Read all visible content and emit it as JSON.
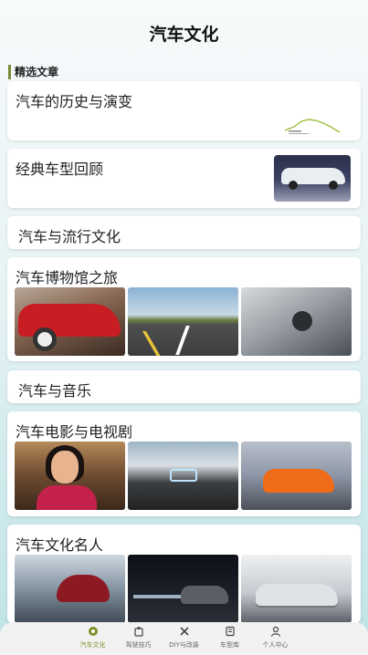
{
  "header": {
    "title": "汽车文化"
  },
  "section": {
    "label": "精选文章"
  },
  "articles": [
    {
      "title": "汽车的历史与演变"
    },
    {
      "title": "经典车型回顾"
    },
    {
      "title": "汽车与流行文化"
    },
    {
      "title": "汽车博物馆之旅"
    },
    {
      "title": "汽车与音乐"
    },
    {
      "title": "汽车电影与电视剧"
    },
    {
      "title": "汽车文化名人"
    }
  ],
  "tabbar": {
    "items": [
      {
        "label": "汽车文化",
        "icon": "steering-wheel-icon",
        "active": true
      },
      {
        "label": "驾驶技巧",
        "icon": "driver-icon",
        "active": false
      },
      {
        "label": "DIY与改装",
        "icon": "tools-icon",
        "active": false
      },
      {
        "label": "车型库",
        "icon": "book-icon",
        "active": false
      },
      {
        "label": "个人中心",
        "icon": "user-icon",
        "active": false
      }
    ]
  },
  "colors": {
    "accent": "#7f8f2a"
  }
}
